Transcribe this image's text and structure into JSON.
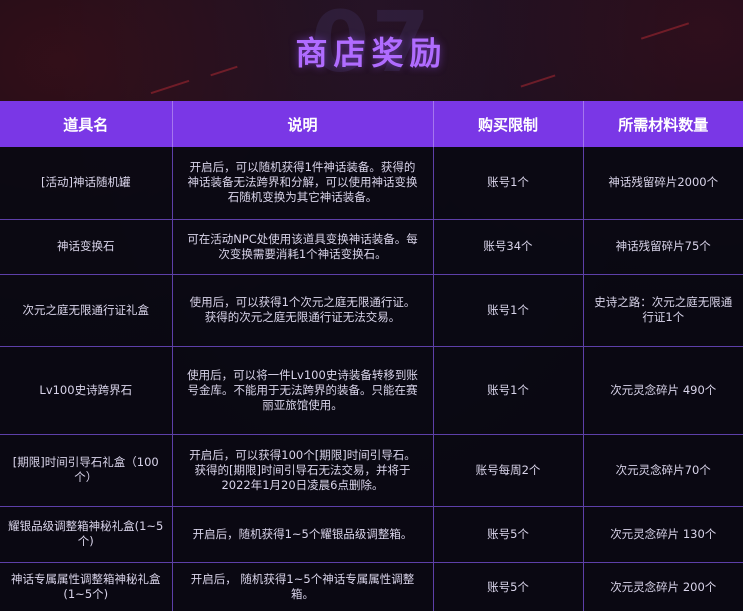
{
  "header": {
    "watermark": "07",
    "title": "商店奖励"
  },
  "table": {
    "columns": [
      "道具名",
      "说明",
      "购买限制",
      "所需材料数量"
    ],
    "rows": [
      {
        "name": "[活动]神话随机罐",
        "description": "开启后，可以随机获得1件神话装备。获得的神话装备无法跨界和分解，可以使用神话变换石随机变换为其它神话装备。",
        "limit": "账号1个",
        "cost": "神话残留碎片2000个"
      },
      {
        "name": "神话变换石",
        "description": "可在活动NPC处使用该道具变换神话装备。每次变换需要消耗1个神话变换石。",
        "limit": "账号34个",
        "cost": "神话残留碎片75个"
      },
      {
        "name": "次元之庭无限通行证礼盒",
        "description": "使用后，可以获得1个次元之庭无限通行证。获得的次元之庭无限通行证无法交易。",
        "limit": "账号1个",
        "cost": "史诗之路：次元之庭无限通行证1个"
      },
      {
        "name": "Lv100史诗跨界石",
        "description": "使用后，可以将一件Lv100史诗装备转移到账号金库。不能用于无法跨界的装备。只能在赛丽亚旅馆使用。",
        "limit": "账号1个",
        "cost": "次元灵念碎片 490个"
      },
      {
        "name": "[期限]时间引导石礼盒（100个）",
        "description": "开启后，可以获得100个[期限]时间引导石。获得的[期限]时间引导石无法交易，并将于2022年1月20日凌晨6点删除。",
        "limit": "账号每周2个",
        "cost": "次元灵念碎片70个"
      },
      {
        "name": "耀银品级调整箱神秘礼盒(1~5个)",
        "description": "开启后，随机获得1~5个耀银品级调整箱。",
        "limit": "账号5个",
        "cost": "次元灵念碎片 130个"
      },
      {
        "name": "神话专属属性调整箱神秘礼盒 (1~5个)",
        "description": "开启后， 随机获得1~5个神话专属属性调整箱。",
        "limit": "账号5个",
        "cost": "次元灵念碎片 200个"
      }
    ]
  }
}
